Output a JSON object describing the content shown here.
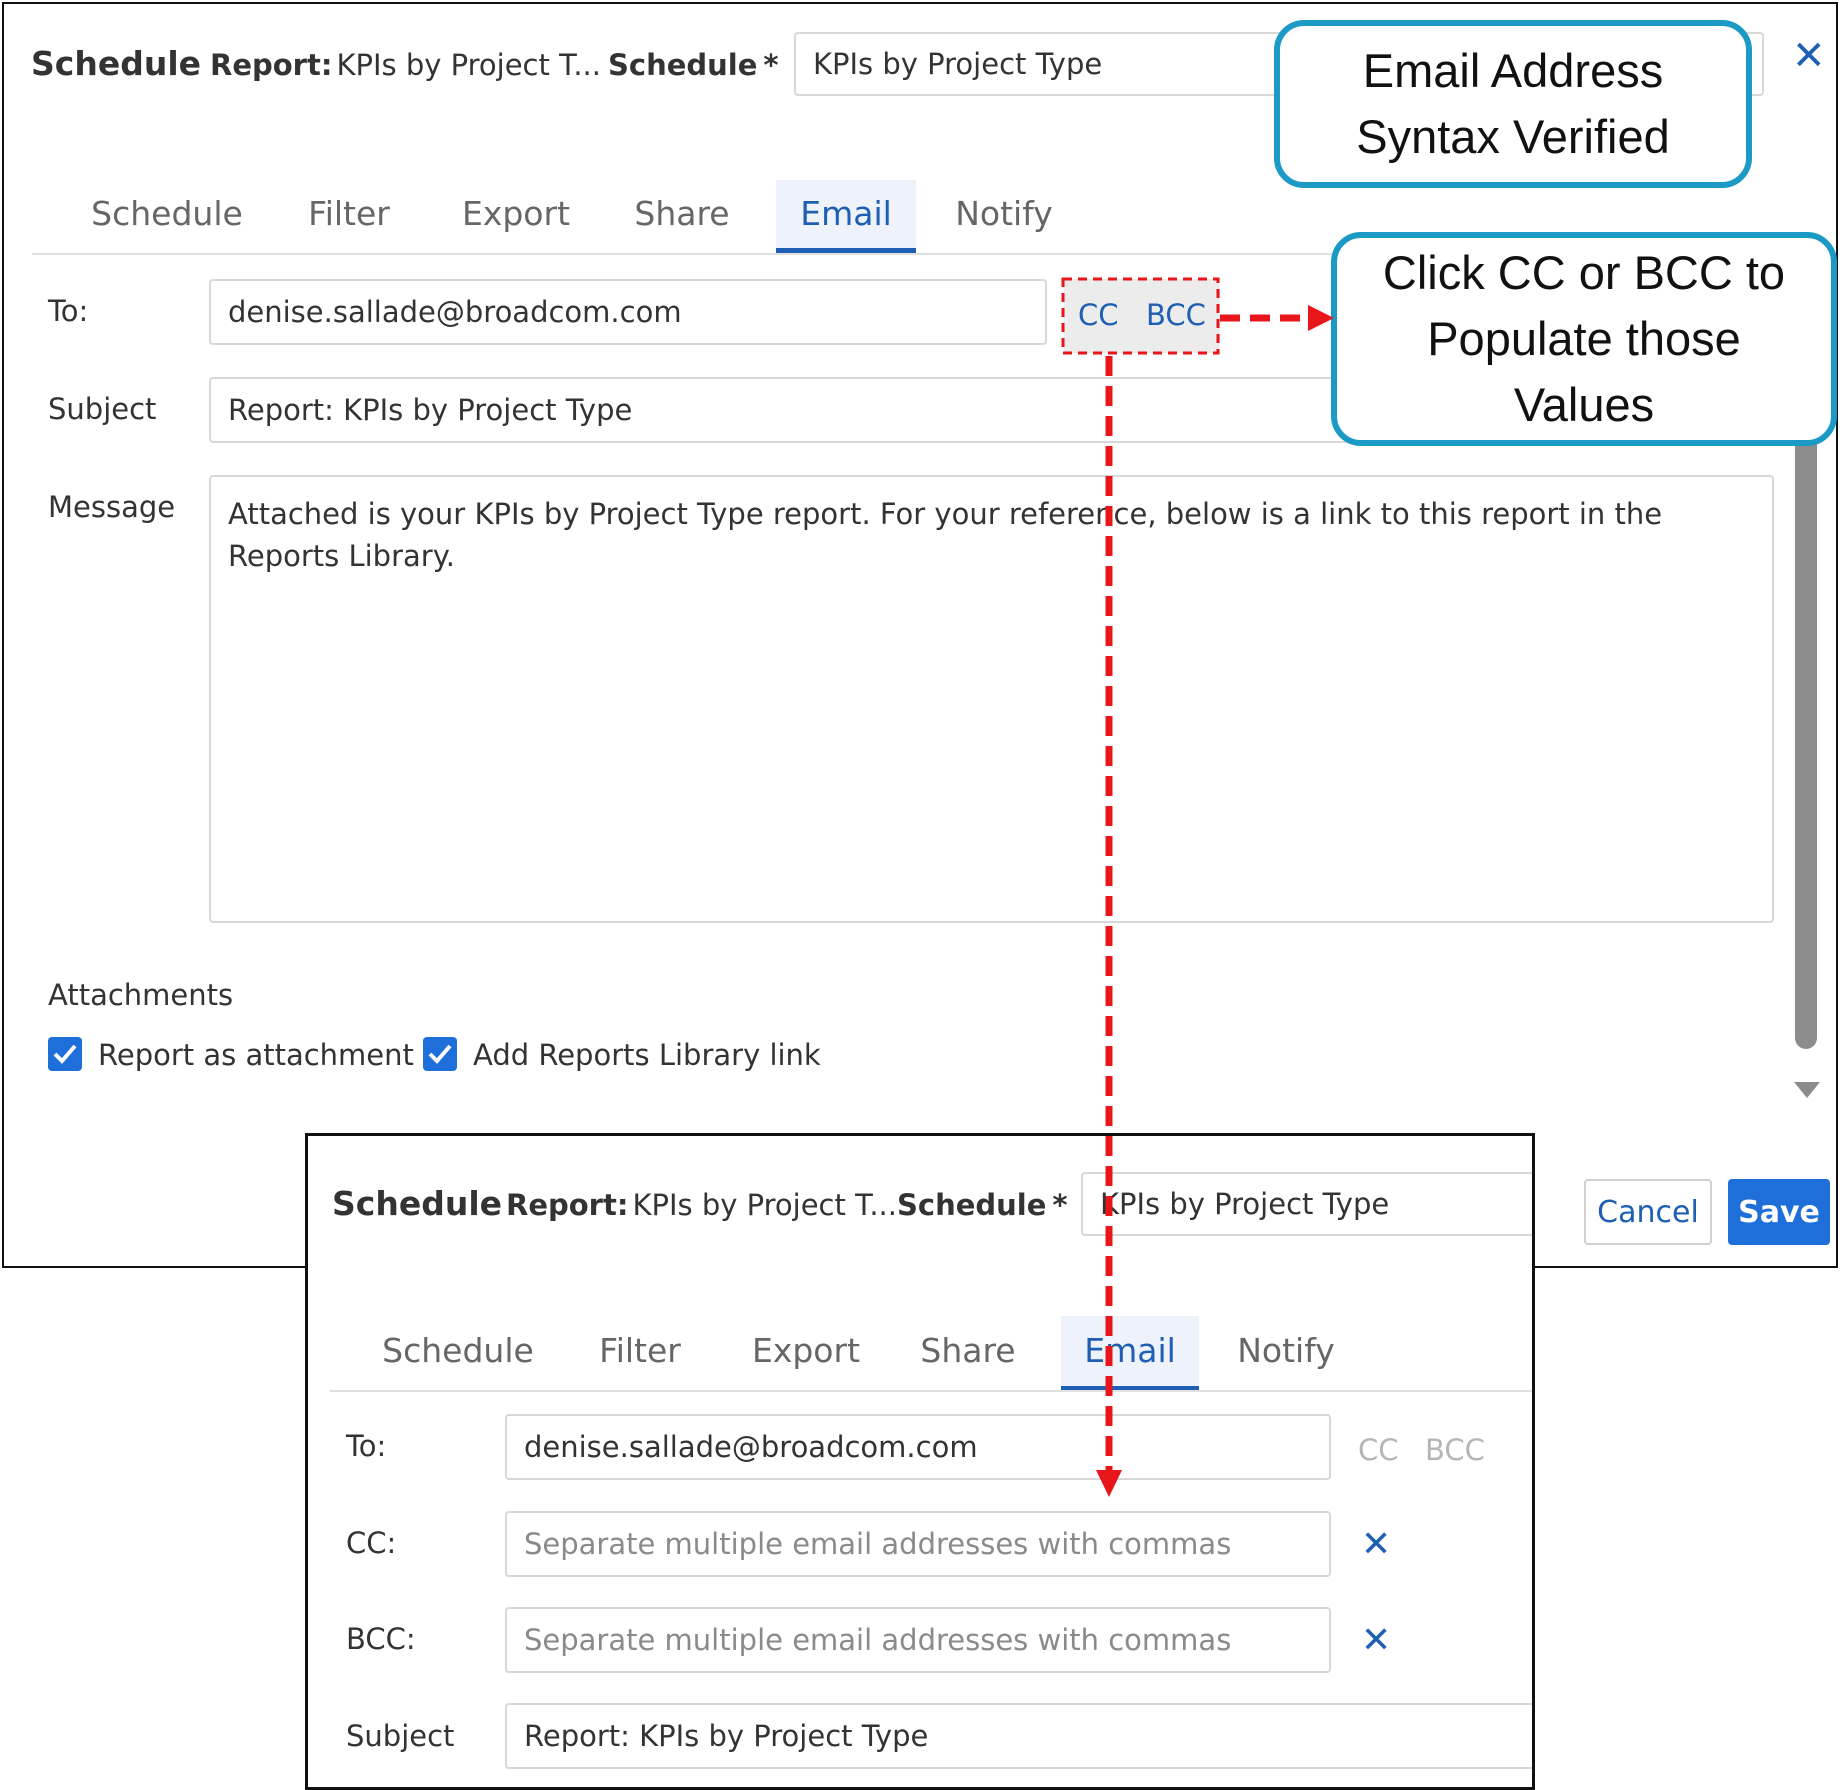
{
  "dialog": {
    "title": "Schedule",
    "report_label": "Report:",
    "report_name": "KPIs by Project T...",
    "schedule_label": "Schedule",
    "required_mark": "*",
    "schedule_name": "KPIs by Project Type",
    "close_icon": "close-icon",
    "tabs": [
      {
        "label": "Schedule",
        "active": false
      },
      {
        "label": "Filter",
        "active": false
      },
      {
        "label": "Export",
        "active": false
      },
      {
        "label": "Share",
        "active": false
      },
      {
        "label": "Email",
        "active": true
      },
      {
        "label": "Notify",
        "active": false
      }
    ],
    "to_label": "To:",
    "to_value": "denise.sallade@broadcom.com",
    "cc_link": "CC",
    "bcc_link": "BCC",
    "subject_label": "Subject",
    "subject_value": "Report:  KPIs by Project Type",
    "message_label": "Message",
    "message_value": "Attached is your KPIs by Project Type report.  For your reference, below is a link to this report in the Reports Library.",
    "attachments_label": "Attachments",
    "attach_report_label": "Report as attachment",
    "attach_report_checked": true,
    "library_link_label": "Add Reports Library link",
    "library_link_checked": true,
    "cancel_label": "Cancel",
    "save_label": "Save"
  },
  "callouts": {
    "syntax_verified": "Email Address Syntax Verified",
    "cc_bcc_hint": "Click CC or BCC to Populate those Values"
  },
  "zoom": {
    "title": "Schedule",
    "report_label": "Report:",
    "report_name": "KPIs by Project T...",
    "schedule_label": "Schedule",
    "required_mark": "*",
    "schedule_name": "KPIs by Project Type",
    "tabs": [
      {
        "label": "Schedule",
        "active": false
      },
      {
        "label": "Filter",
        "active": false
      },
      {
        "label": "Export",
        "active": false
      },
      {
        "label": "Share",
        "active": false
      },
      {
        "label": "Email",
        "active": true
      },
      {
        "label": "Notify",
        "active": false
      }
    ],
    "to_label": "To:",
    "to_value": "denise.sallade@broadcom.com",
    "cc_link": "CC",
    "bcc_link": "BCC",
    "cc_label": "CC:",
    "cc_placeholder": "Separate multiple email addresses with commas",
    "bcc_label": "BCC:",
    "bcc_placeholder": "Separate multiple email addresses with commas",
    "subject_label": "Subject",
    "subject_value": "Report:  KPIs by Project Type"
  },
  "colors": {
    "accent": "#1e5fb4",
    "checkbox": "#1e6fd9",
    "callout_border": "#1a9ac5",
    "annotation": "#e8151b"
  }
}
